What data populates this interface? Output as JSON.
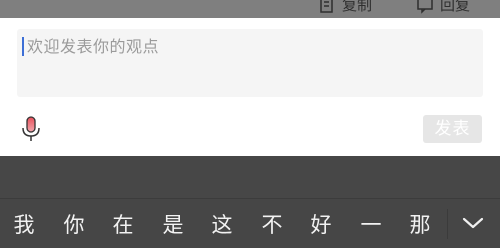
{
  "top_actions": {
    "copy_label": "复制",
    "reply_label": "回复"
  },
  "comment": {
    "placeholder": "欢迎发表你的观点",
    "submit_label": "发表",
    "mic_icon": "microphone-icon"
  },
  "keyboard": {
    "candidates": [
      "我",
      "你",
      "在",
      "是",
      "这",
      "不",
      "好",
      "一",
      "那"
    ],
    "expand_icon": "chevron-down-icon"
  },
  "colors": {
    "caret": "#3d6fd6",
    "placeholder": "#9b9b9b",
    "keyboard_bg": "#464646",
    "submit_bg": "#e6e6e6"
  }
}
